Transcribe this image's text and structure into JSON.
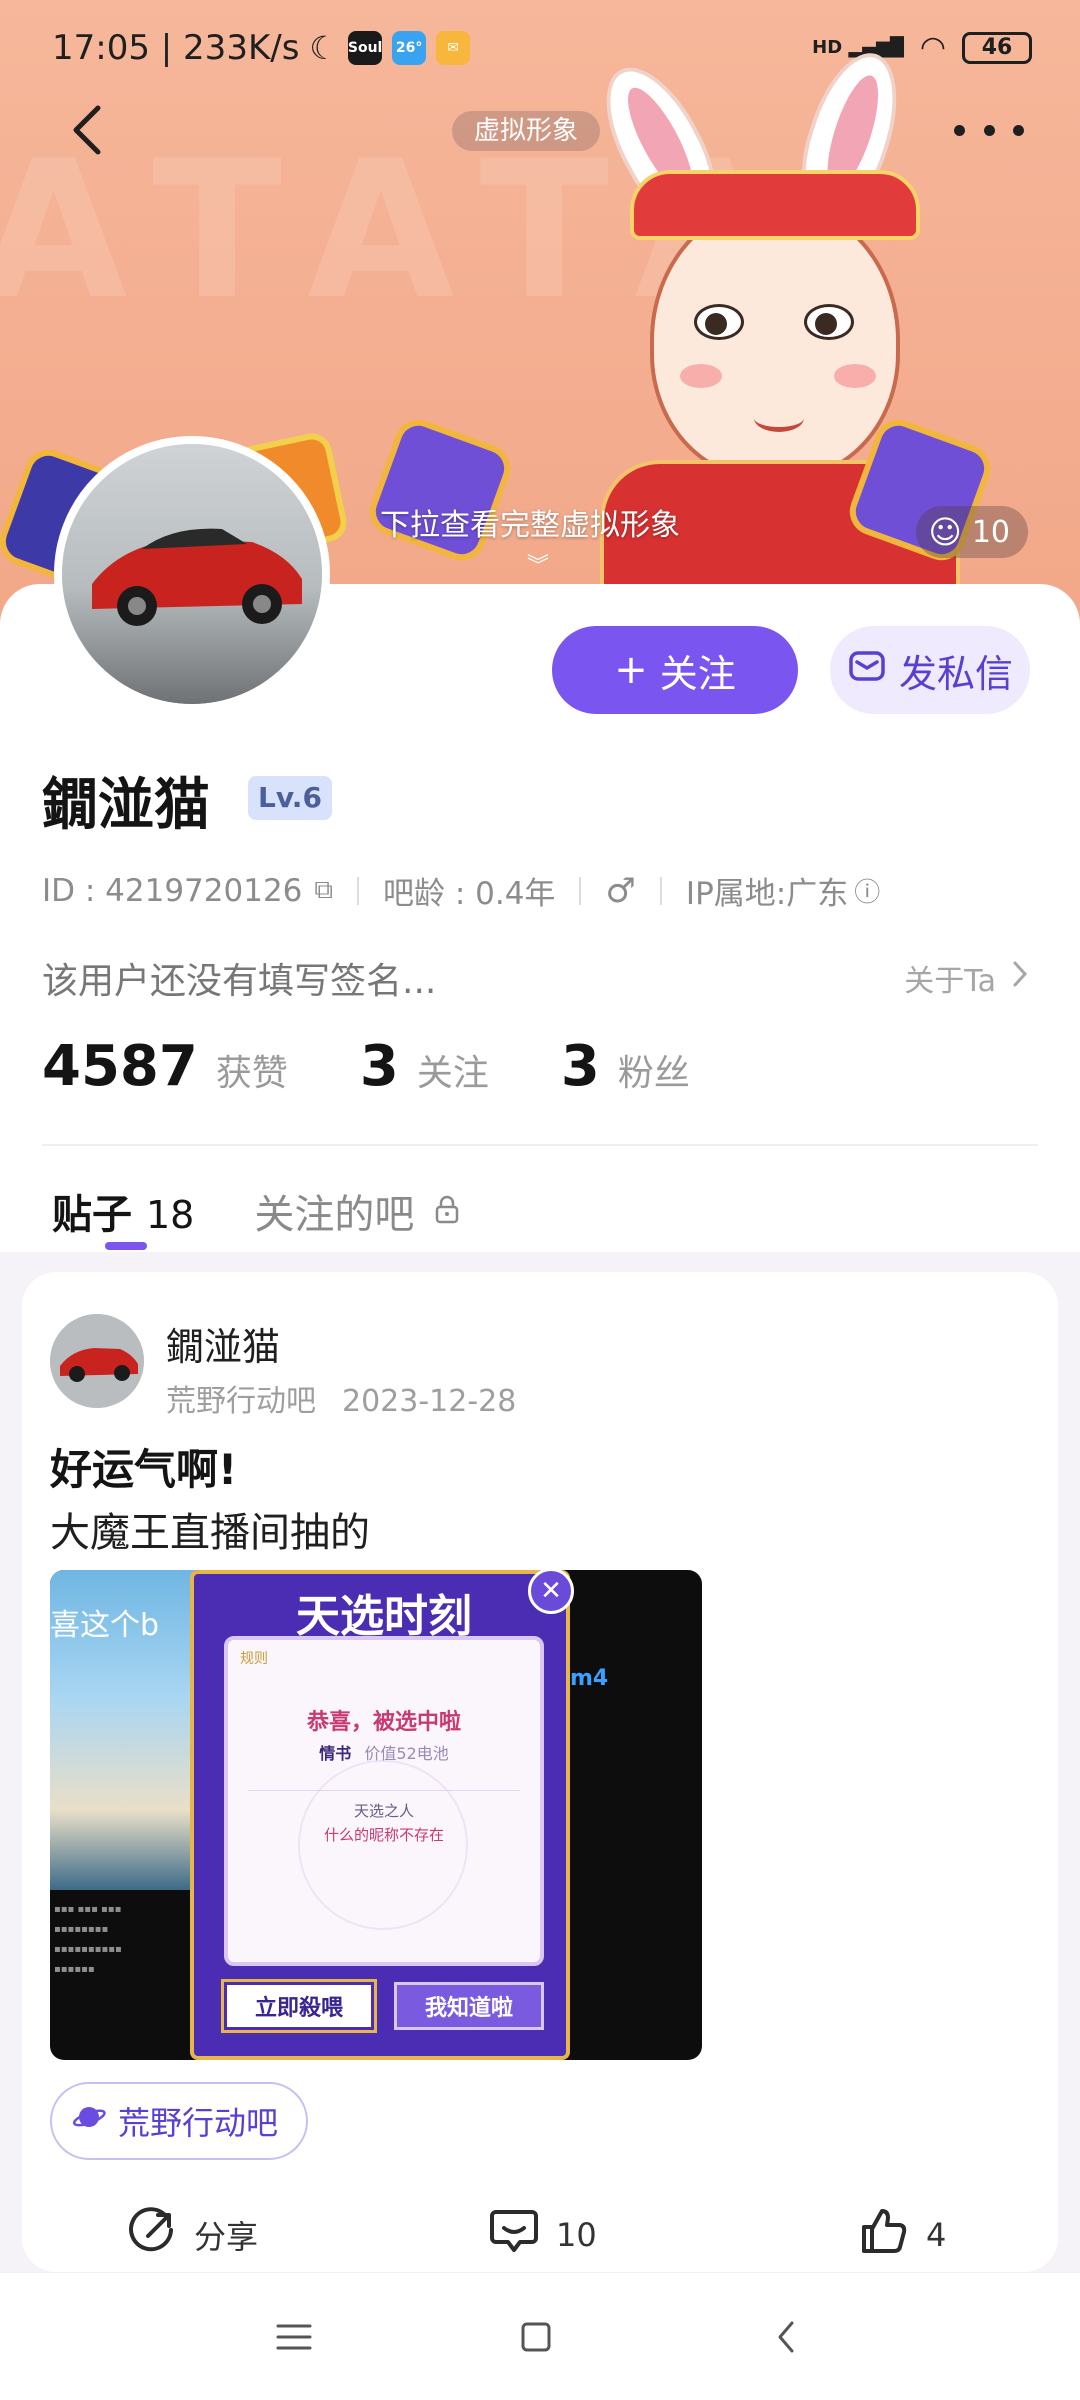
{
  "status_bar": {
    "time_speed": "17:05 | 233K/s",
    "app1": "Soul",
    "app2": "26°",
    "network": "HD",
    "battery": "46"
  },
  "header": {
    "virtual_pill": "虚拟形象",
    "pull_hint": "下拉查看完整虚拟形象",
    "like_count": "10"
  },
  "profile": {
    "username": "鐗湴猫",
    "level": "Lv.6",
    "id_text": "ID : 4219720126",
    "age_text": "吧龄 : 0.4年",
    "gender_symbol": "♂",
    "ip_text": "IP属地:广东",
    "bio": "该用户还没有填写签名...",
    "about_link": "关于Ta",
    "follow_button": "关注",
    "message_button": "发私信",
    "stats": [
      {
        "value": "4587",
        "label": "获赞"
      },
      {
        "value": "3",
        "label": "关注"
      },
      {
        "value": "3",
        "label": "粉丝"
      }
    ]
  },
  "tabs": {
    "posts_label": "贴子",
    "posts_count": "18",
    "followed_label": "关注的吧"
  },
  "post": {
    "author": "鐗湴猫",
    "forum": "荒野行动吧",
    "date": "2023-12-28",
    "title": "好运气啊!",
    "body": "大魔王直播间抽的",
    "forum_tag": "荒野行动吧",
    "share_label": "分享",
    "comment_count": "10",
    "like_count": "4"
  },
  "post_image": {
    "beach_text": "喜这个b",
    "side_text": "m4",
    "modal_title": "天选时刻",
    "modal_rule": "规则",
    "modal_congrats": "恭喜，被选中啦",
    "modal_prize_name": "情书",
    "modal_prize_value": "价值52电池",
    "modal_chosen": "天选之人",
    "modal_nick": "什么的昵称不存在",
    "btn_left": "立即殺喂",
    "btn_right": "我知道啦"
  },
  "colors": {
    "accent": "#7a55f0",
    "hero_bg": "#f4ad90",
    "feed_bg": "#f6f3f8"
  }
}
